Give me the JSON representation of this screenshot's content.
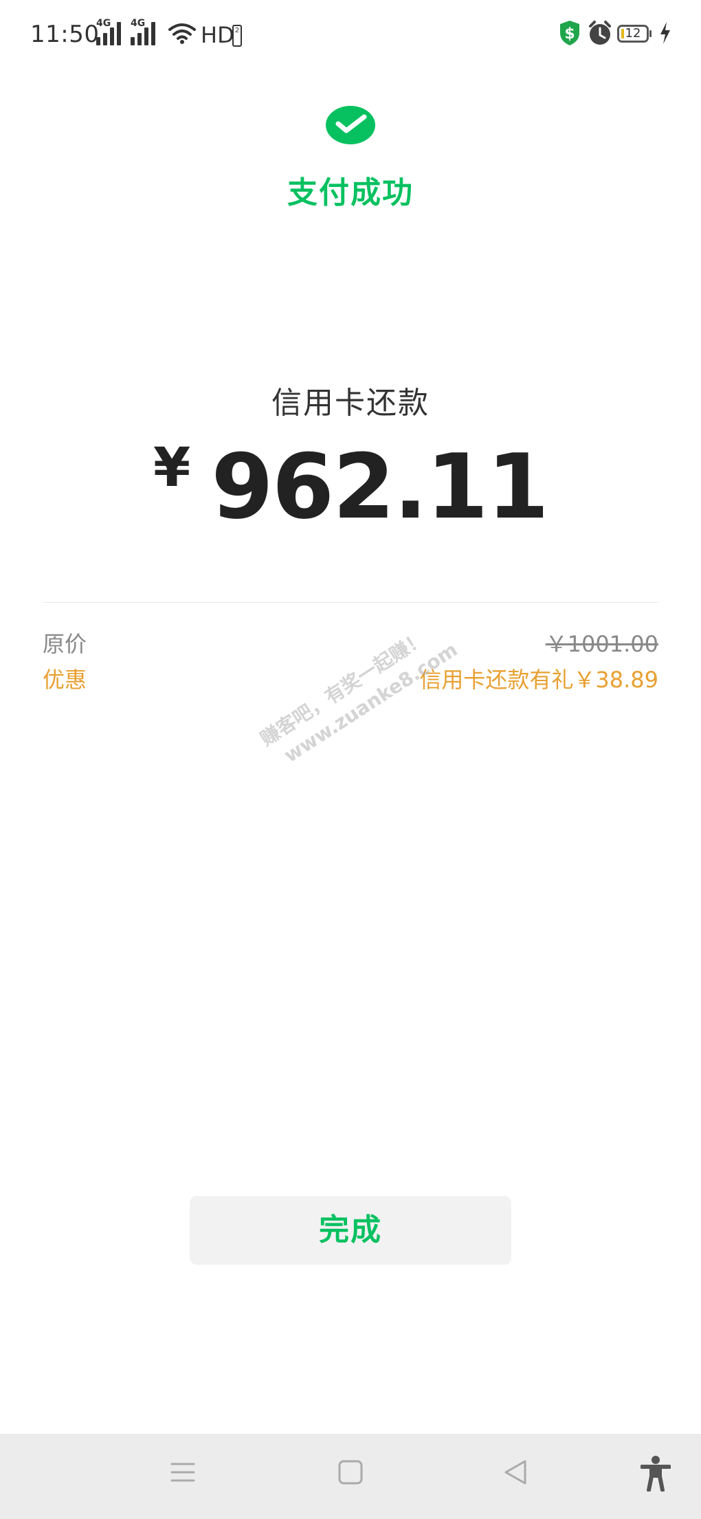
{
  "status_bar": {
    "time": "11:50",
    "signal_1_label": "4G",
    "signal_2_label": "4G",
    "hd_label": "HD",
    "hd_sub": "2",
    "battery_level": "12",
    "icons": [
      "signal-icon",
      "wifi-icon",
      "shield-dollar-icon",
      "alarm-icon",
      "battery-icon",
      "charging-bolt-icon"
    ]
  },
  "header": {
    "status_text": "支付成功"
  },
  "payment": {
    "merchant": "信用卡还款",
    "currency_symbol": "¥",
    "amount": "962.11"
  },
  "details": {
    "original_label": "原价",
    "original_value": "￥1001.00",
    "discount_label": "优惠",
    "discount_value": "信用卡还款有礼￥38.89"
  },
  "watermark": {
    "line1": "赚客吧，有奖一起赚！",
    "line2": "www.zuanke8.com"
  },
  "actions": {
    "done_label": "完成"
  },
  "colors": {
    "brand_green": "#07c160",
    "discount_orange": "#e8a031",
    "text_dark": "#222222",
    "text_gray": "#888888"
  },
  "nav_bar": {
    "icons": [
      "menu-icon",
      "home-icon",
      "back-icon",
      "accessibility-icon"
    ]
  }
}
